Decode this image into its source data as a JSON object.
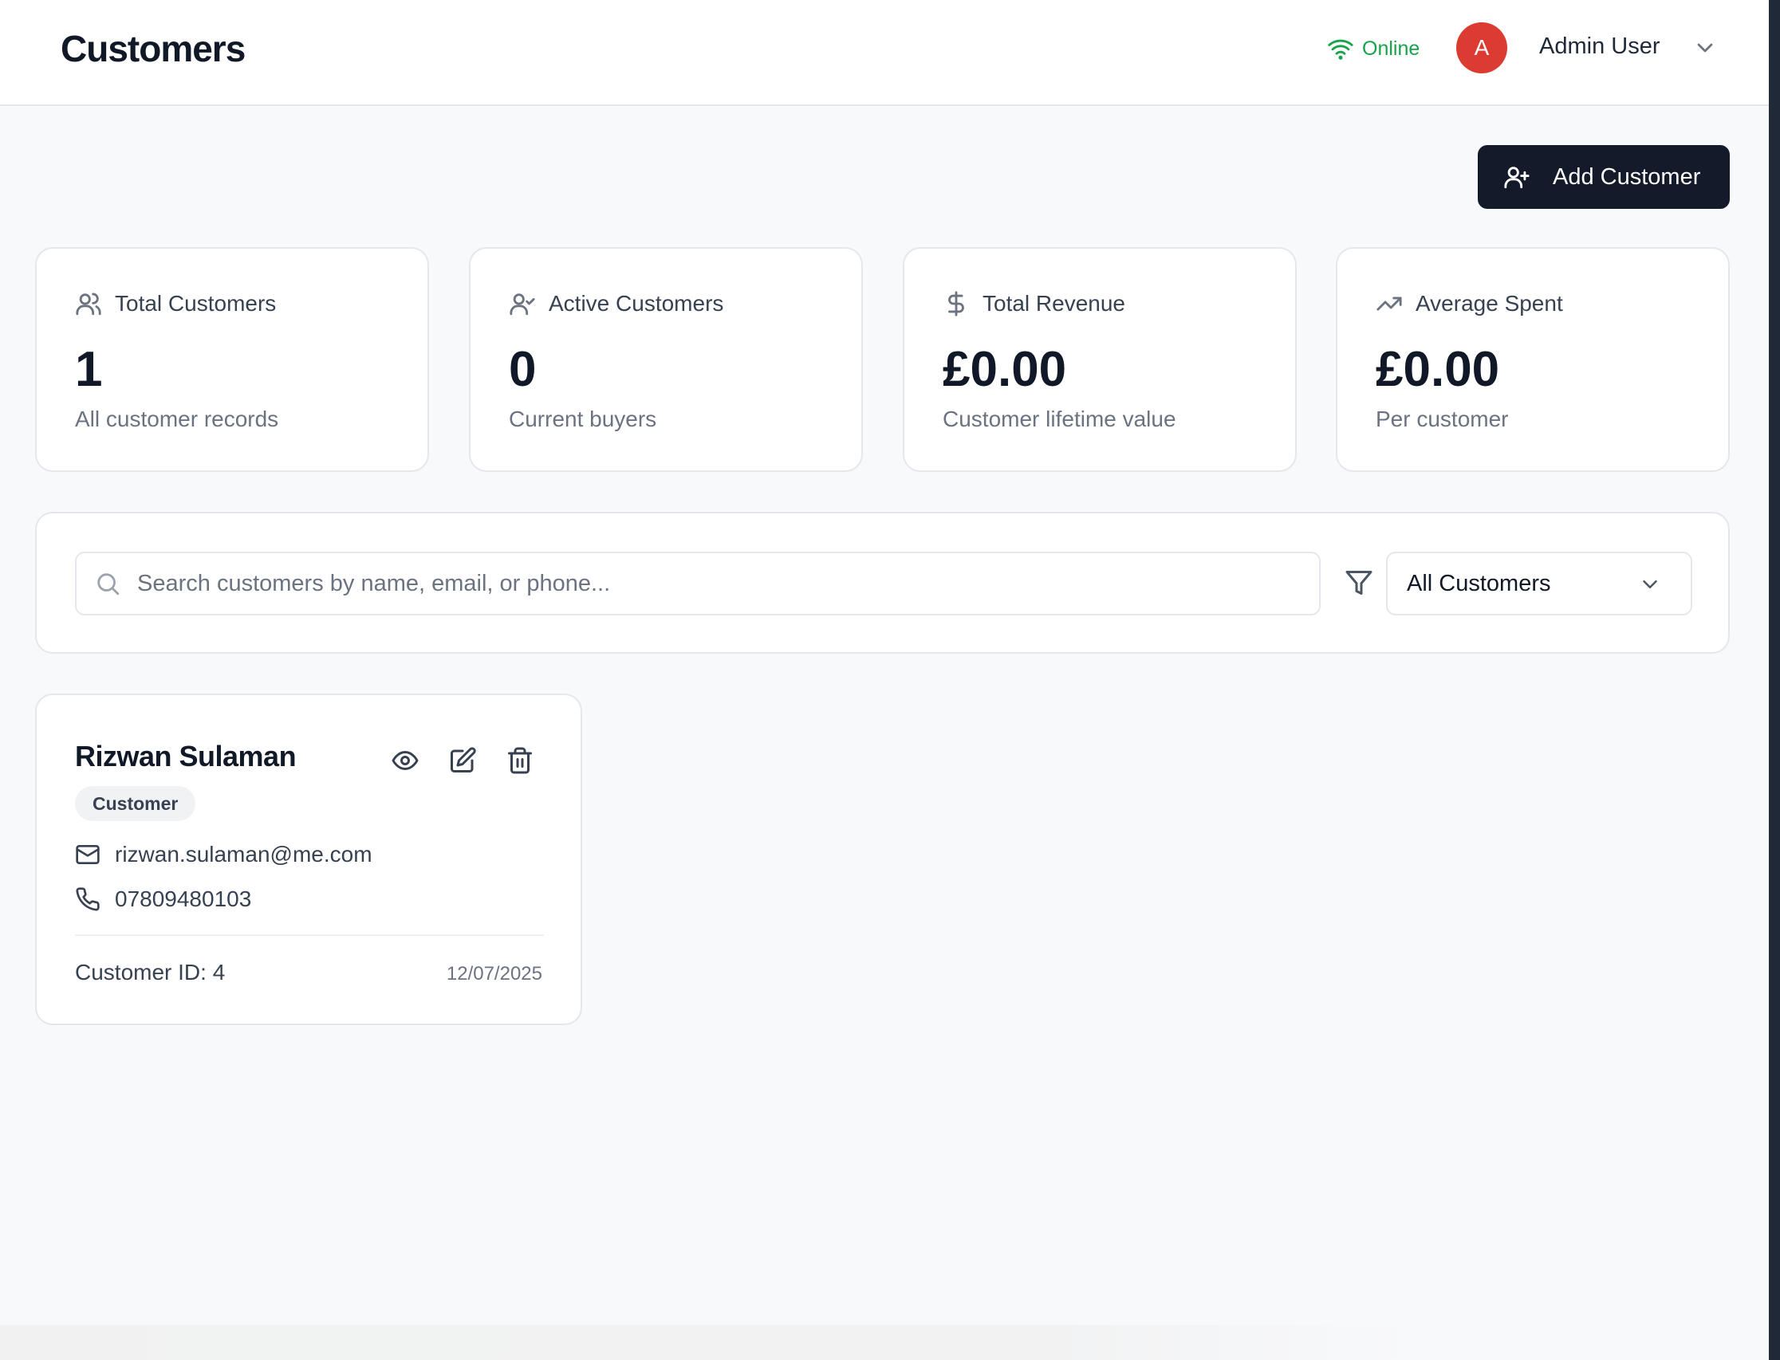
{
  "header": {
    "title": "Customers",
    "status": {
      "label": "Online",
      "icon": "wifi-icon",
      "color": "#16a34a"
    },
    "user": {
      "avatar_initial": "A",
      "avatar_color": "#dc3b32",
      "name": "Admin User"
    }
  },
  "actions": {
    "add_customer_label": "Add Customer"
  },
  "stats": [
    {
      "label": "Total Customers",
      "icon": "users-icon",
      "value": "1",
      "sub": "All customer records"
    },
    {
      "label": "Active Customers",
      "icon": "user-check-icon",
      "value": "0",
      "sub": "Current buyers"
    },
    {
      "label": "Total Revenue",
      "icon": "dollar-icon",
      "value": "£0.00",
      "sub": "Customer lifetime value"
    },
    {
      "label": "Average Spent",
      "icon": "trending-up-icon",
      "value": "£0.00",
      "sub": "Per customer"
    }
  ],
  "filters": {
    "search_placeholder": "Search customers by name, email, or phone...",
    "search_value": "",
    "segment_selected": "All Customers"
  },
  "customers": [
    {
      "name": "Rizwan Sulaman",
      "role": "Customer",
      "email": "rizwan.sulaman@me.com",
      "phone": "07809480103",
      "id_label": "Customer ID: 4",
      "date": "12/07/2025"
    }
  ],
  "colors": {
    "accent_dark": "#131a29",
    "border": "#e5e7eb",
    "background": "#f8f9fb"
  }
}
